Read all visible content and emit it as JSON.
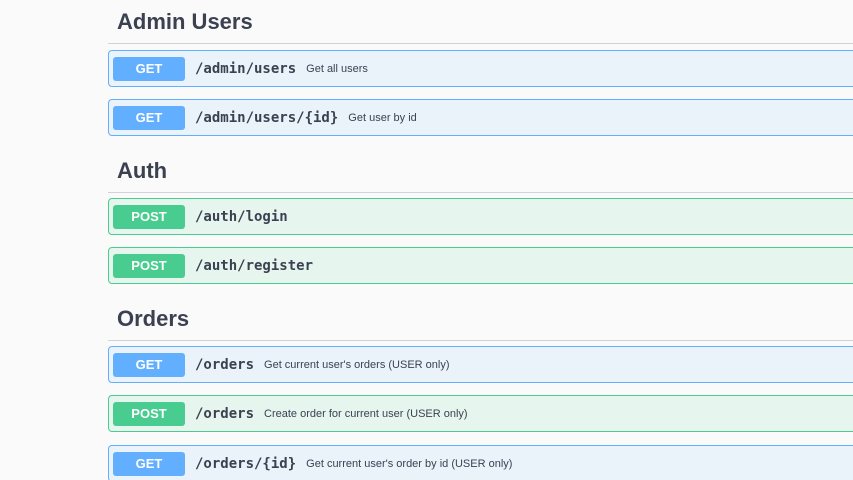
{
  "sections": [
    {
      "title": "Admin Users",
      "operations": [
        {
          "method": "GET",
          "path": "/admin/users",
          "summary": "Get all users"
        },
        {
          "method": "GET",
          "path": "/admin/users/{id}",
          "summary": "Get user by id"
        }
      ]
    },
    {
      "title": "Auth",
      "operations": [
        {
          "method": "POST",
          "path": "/auth/login",
          "summary": ""
        },
        {
          "method": "POST",
          "path": "/auth/register",
          "summary": ""
        }
      ]
    },
    {
      "title": "Orders",
      "operations": [
        {
          "method": "GET",
          "path": "/orders",
          "summary": "Get current user's orders (USER only)"
        },
        {
          "method": "POST",
          "path": "/orders",
          "summary": "Create order for current user (USER only)"
        },
        {
          "method": "GET",
          "path": "/orders/{id}",
          "summary": "Get current user's order by id (USER only)"
        }
      ]
    }
  ],
  "colors": {
    "get": "#61affe",
    "post": "#49cc90",
    "text": "#3b4151",
    "background": "#fafafa"
  }
}
